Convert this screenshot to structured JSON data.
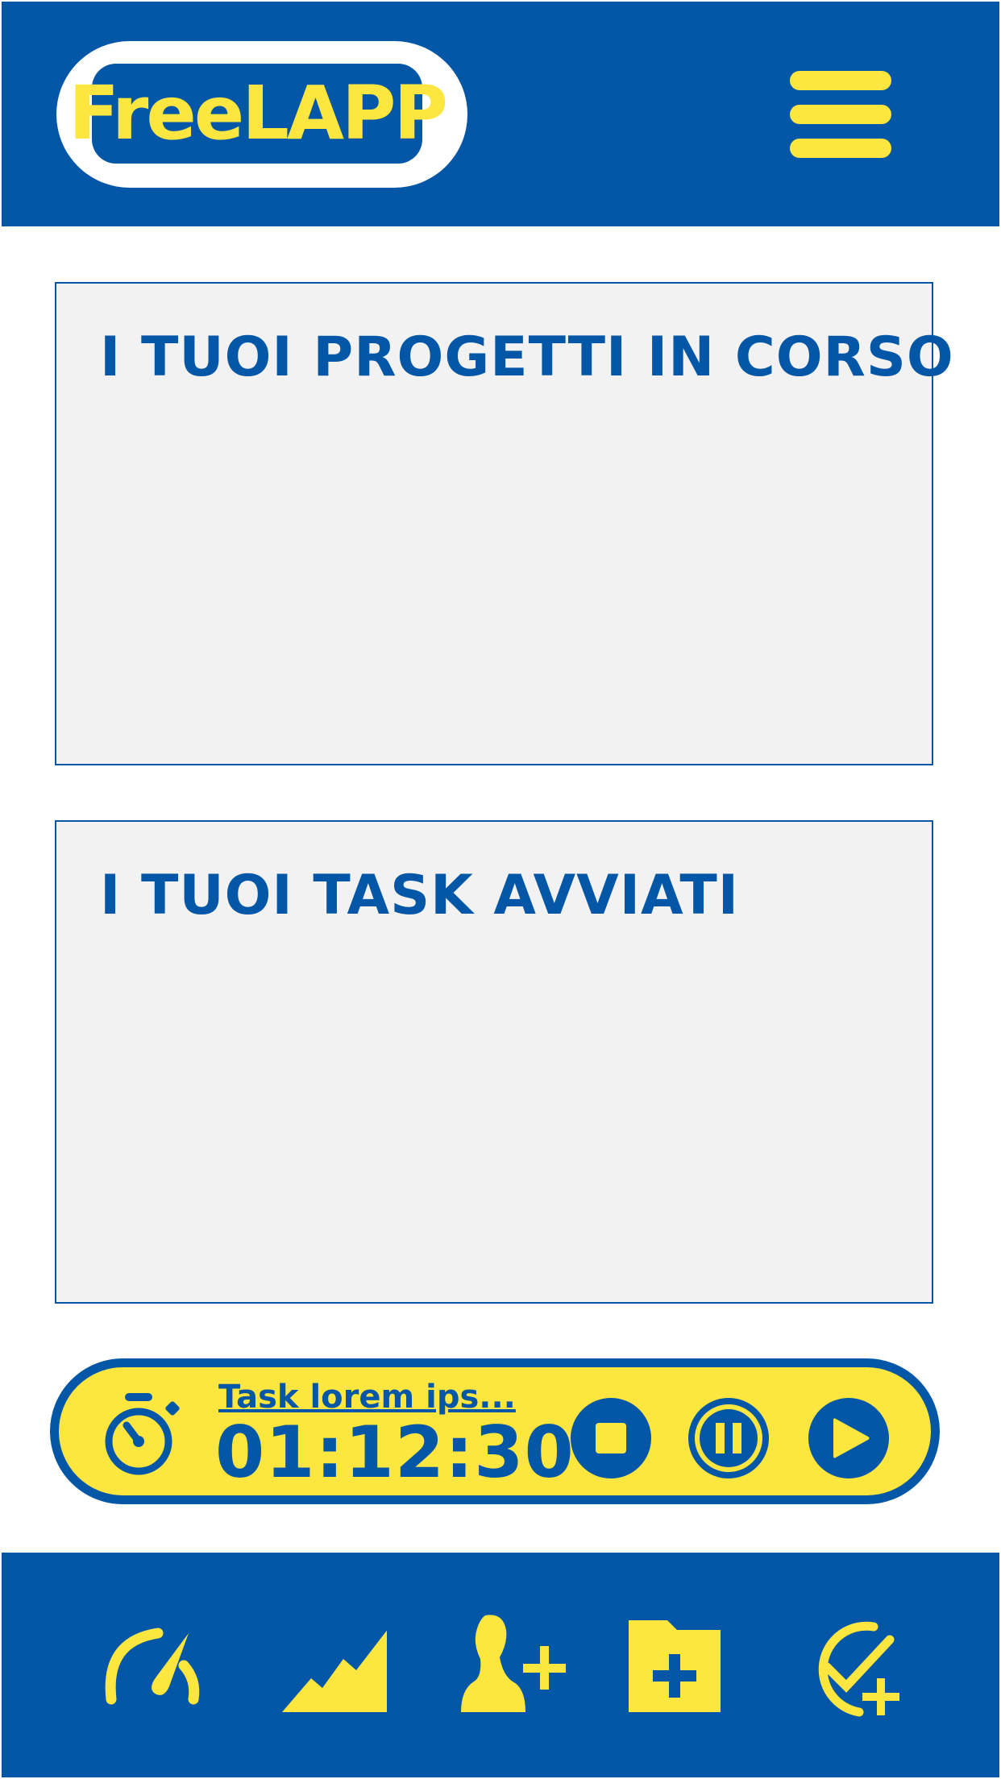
{
  "app": {
    "logo_text": "FreeLAPP",
    "menu_icon": "hamburger-menu-icon"
  },
  "colors": {
    "primary": "#0357a6",
    "accent": "#fde63f",
    "card_background": "#f2f2f2",
    "page_background": "#ffffff"
  },
  "sections": {
    "projects_title": "I TUOI PROGETTI IN CORSO",
    "tasks_title": "I TUOI TASK AVVIATI"
  },
  "timer": {
    "task_name": "Task lorem ips...",
    "elapsed": "01:12:30",
    "icon": "stopwatch-icon",
    "controls": [
      "stop-icon",
      "pause-icon",
      "play-icon"
    ]
  },
  "bottom_nav": {
    "items": [
      "speedometer-icon",
      "area-chart-icon",
      "add-person-icon",
      "add-folder-icon",
      "add-task-check-icon"
    ]
  }
}
